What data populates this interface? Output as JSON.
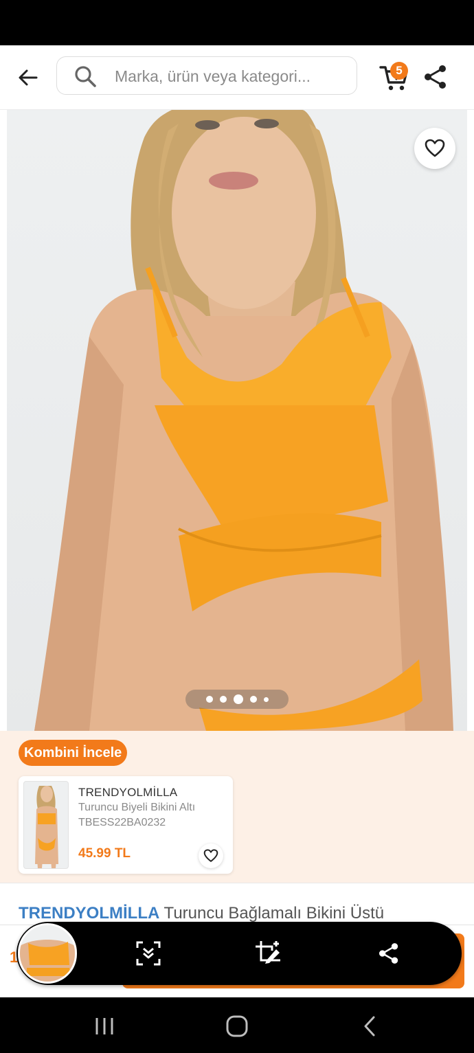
{
  "search": {
    "placeholder": "Marka, ürün veya kategori..."
  },
  "cart": {
    "badge": "5"
  },
  "gallery": {
    "image_count": 5,
    "active_index": 2
  },
  "combo": {
    "button_label": "Kombini İncele",
    "product": {
      "brand": "TRENDYOLMİLLA",
      "name": "Turuncu Biyeli Bikini Altı",
      "code": "TBESS22BA0232",
      "price": "45.99 TL"
    }
  },
  "product": {
    "brand": "TRENDYOLMİLLA",
    "name": "Turuncu Bağlamalı Bikini Üstü",
    "price_partial": "1"
  },
  "colors": {
    "accent": "#f27a1a",
    "brand_blue": "#3c7fc4"
  },
  "icons": [
    "back-arrow-icon",
    "search-icon",
    "cart-icon",
    "share-icon",
    "heart-icon",
    "scroll-capture-icon",
    "crop-edit-icon",
    "recents-icon",
    "home-icon",
    "nav-back-icon"
  ]
}
